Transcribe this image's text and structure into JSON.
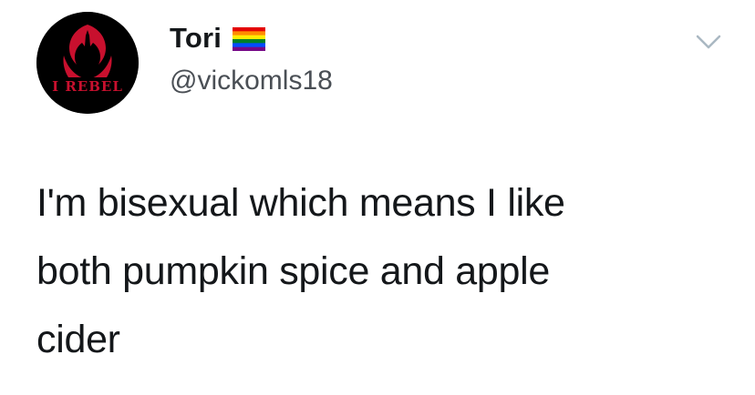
{
  "user": {
    "display_name": "Tori",
    "handle": "@vickomls18",
    "avatar_text": "I REBEL",
    "flag_icon": "rainbow-flag-icon",
    "flag_colors": [
      "#e40303",
      "#ff8c00",
      "#ffed00",
      "#008026",
      "#004dff",
      "#750787"
    ]
  },
  "menu": {
    "icon": "chevron-down-icon"
  },
  "tweet": {
    "lines": [
      "I'm bisexual which means I like",
      "both pumpkin spice and apple",
      "cider"
    ]
  },
  "colors": {
    "avatar_bg": "#000000",
    "avatar_emblem": "#c8102e",
    "text": "#14171a",
    "handle": "#4a4f55",
    "chevron": "#aab8c2"
  }
}
